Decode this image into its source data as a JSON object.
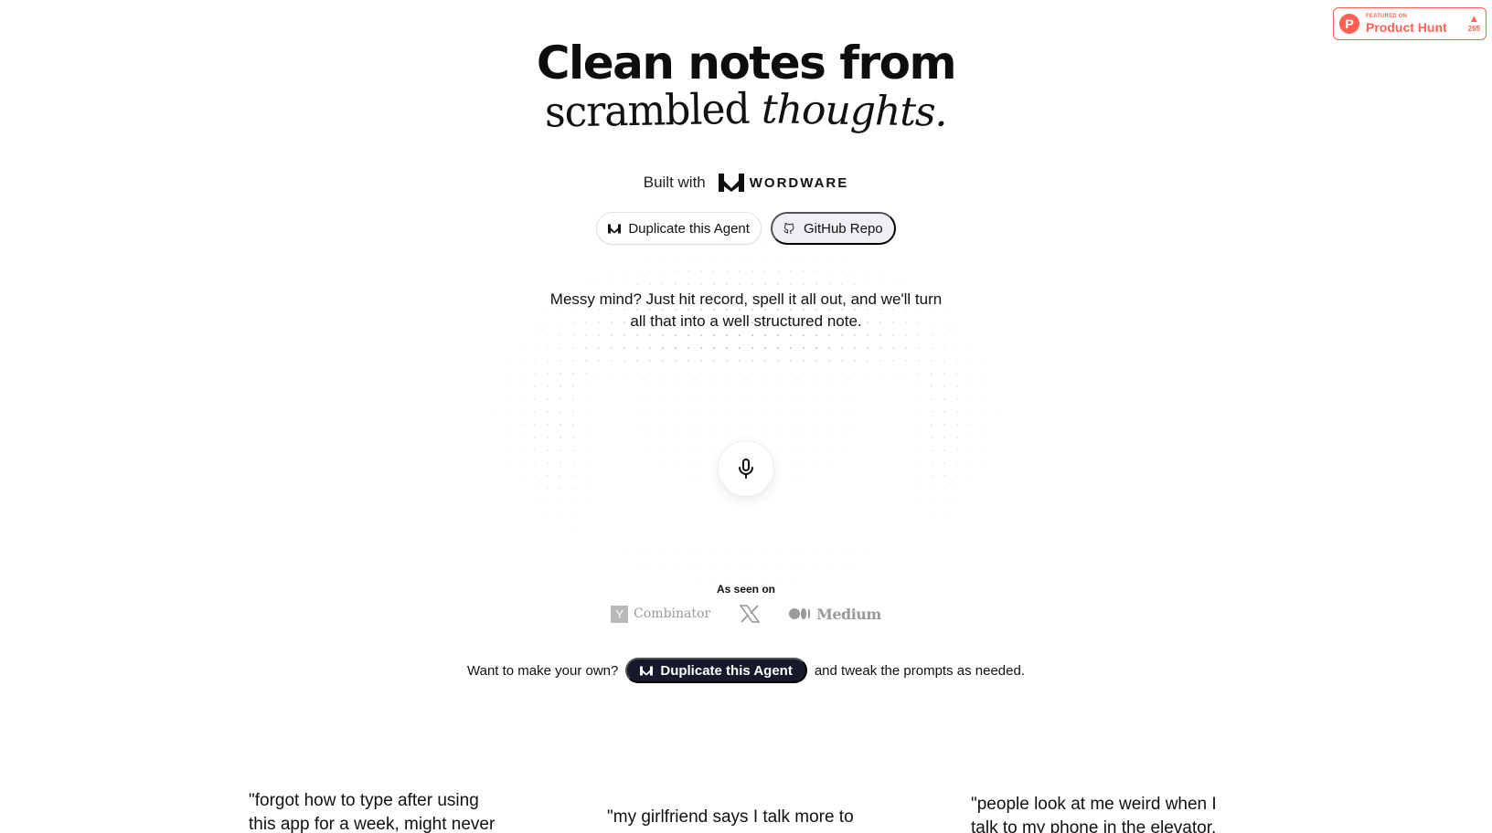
{
  "product_hunt": {
    "featured_label": "FEATURED ON",
    "name": "Product Hunt",
    "logo_letter": "P",
    "vote_count": "265",
    "color": "#ff6154"
  },
  "hero": {
    "title": "Clean notes from",
    "subtitle_word1": "scrambled",
    "subtitle_word2": "thoughts."
  },
  "built_with": {
    "label": "Built with",
    "brand": "WORDWARE",
    "icon": "wordware-logo-icon"
  },
  "buttons": {
    "duplicate_label": "Duplicate this Agent",
    "duplicate_icon": "wordware-logo-icon",
    "github_label": "GitHub Repo",
    "github_icon": "github-icon"
  },
  "tagline": {
    "line1": "Messy mind? Just hit record, spell it all out, and we'll turn",
    "line2": "all that into a well structured note."
  },
  "recorder": {
    "icon": "microphone-icon"
  },
  "seen_on": {
    "label": "As seen on",
    "yc_letter": "Y",
    "yc_text": "Combinator",
    "x_glyph": "X",
    "medium_text": "Medium"
  },
  "cta": {
    "prefix": "Want to make your own?",
    "button_label": "Duplicate this Agent",
    "suffix": "and tweak the prompts as needed."
  },
  "testimonials": [
    {
      "line1": "\"forgot how to type after using",
      "line2": "this app for a week, might never"
    },
    {
      "line1": "\"my girlfriend says I talk more to",
      "line2": ""
    },
    {
      "line1": "\"people look at me weird when I",
      "line2": "talk to my phone in the elevator,"
    }
  ],
  "colors": {
    "dark_button": "#15192b",
    "soft_button": "#eef0f4",
    "muted_logo": "#9a9a9a"
  }
}
